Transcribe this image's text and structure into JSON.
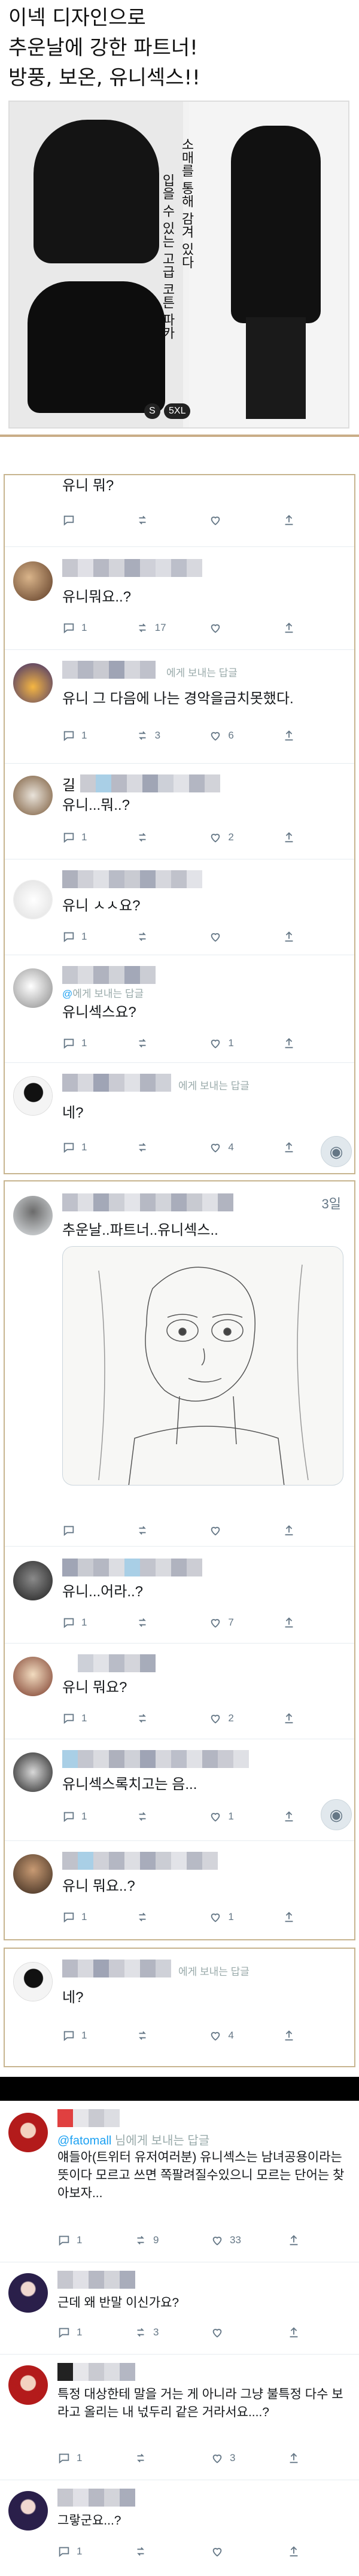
{
  "ad": {
    "headline_1": "이넥 디자인으로",
    "headline_2": "추운날에 강한 파트너!",
    "headline_3": "방풍, 보온, 유니섹스!!",
    "tagline_vertical_1": "입을 수 있는 고급 코튼 파카",
    "tagline_vertical_2": "소매를 통해 감겨 있다",
    "size_min": "S",
    "size_max": "5XL"
  },
  "block1": {
    "top_tweet_text": "유니 뭐?",
    "replies": [
      {
        "text": "유니뭐요..?",
        "reply": "1",
        "retweet": "17",
        "like": ""
      },
      {
        "reply_to": "에게 보내는 답글",
        "text": "유니 그 다음에 나는 경악을금치못했다.",
        "reply": "1",
        "retweet": "3",
        "like": "6"
      },
      {
        "name": "길",
        "text": "유니...뭐..?",
        "reply": "1",
        "retweet": "",
        "like": "2"
      },
      {
        "text": "유니 ㅅㅅ요?",
        "reply": "1",
        "retweet": "",
        "like": ""
      },
      {
        "reply_to": "에게 보내는 답글",
        "text": "유니섹스요?",
        "reply": "1",
        "retweet": "",
        "like": "1"
      },
      {
        "reply_to": "에게 보내는 답글",
        "text": "네?",
        "reply": "1",
        "retweet": "",
        "like": "4"
      }
    ]
  },
  "block2": {
    "time": "3일",
    "main_text": "추운날..파트너..유니섹스..",
    "replies": [
      {
        "text": "유니...어라..?",
        "reply": "1",
        "retweet": "",
        "like": "7"
      },
      {
        "text": "유니 뭐요?",
        "reply": "1",
        "retweet": "",
        "like": "2"
      },
      {
        "text": "유니섹스록치고는 음...",
        "reply": "1",
        "retweet": "",
        "like": "1"
      },
      {
        "text": "유니 뭐요..?",
        "reply": "1",
        "retweet": "",
        "like": "1"
      }
    ]
  },
  "block3": {
    "reply_to": "에게 보내는 답글",
    "text": "네?",
    "reply": "1",
    "retweet": "",
    "like": "4"
  },
  "block4": {
    "replies": [
      {
        "reply_to_handle": "@fatomall",
        "reply_to": "님에게 보내는 답글",
        "text": "얘들아(트위터 유저여러분) 유니섹스는 남녀공용이라는 뜻이다 모르고 쓰면 쪽팔려질수있으니 모르는 단어는 찾아보자...",
        "reply": "1",
        "retweet": "9",
        "like": "33"
      },
      {
        "text": "근데 왜 반말 이신가요?",
        "reply": "1",
        "retweet": "3",
        "like": ""
      },
      {
        "text": "특정 대상한테 말을 거는 게 아니라 그냥 불특정 다수 보라고 올리는 내 넋두리 같은 거라서요....?",
        "reply": "1",
        "retweet": "",
        "like": "3"
      },
      {
        "text": "그랗군요...?",
        "reply": "1",
        "retweet": "",
        "like": ""
      }
    ]
  },
  "colors": {
    "border_tan": "#c7b48f",
    "twitter_gray": "#657786",
    "mention_blue": "#1da1f2",
    "mosaic_1": "#b9bbc6",
    "mosaic_2": "#d7d8de",
    "mosaic_3": "#9fa4b5",
    "mosaic_blue": "#a9cfe6"
  },
  "icons": {
    "reply": "speech-bubble-icon",
    "retweet": "retweet-arrows-icon",
    "like": "heart-outline-icon",
    "share": "share-arrow-icon"
  }
}
